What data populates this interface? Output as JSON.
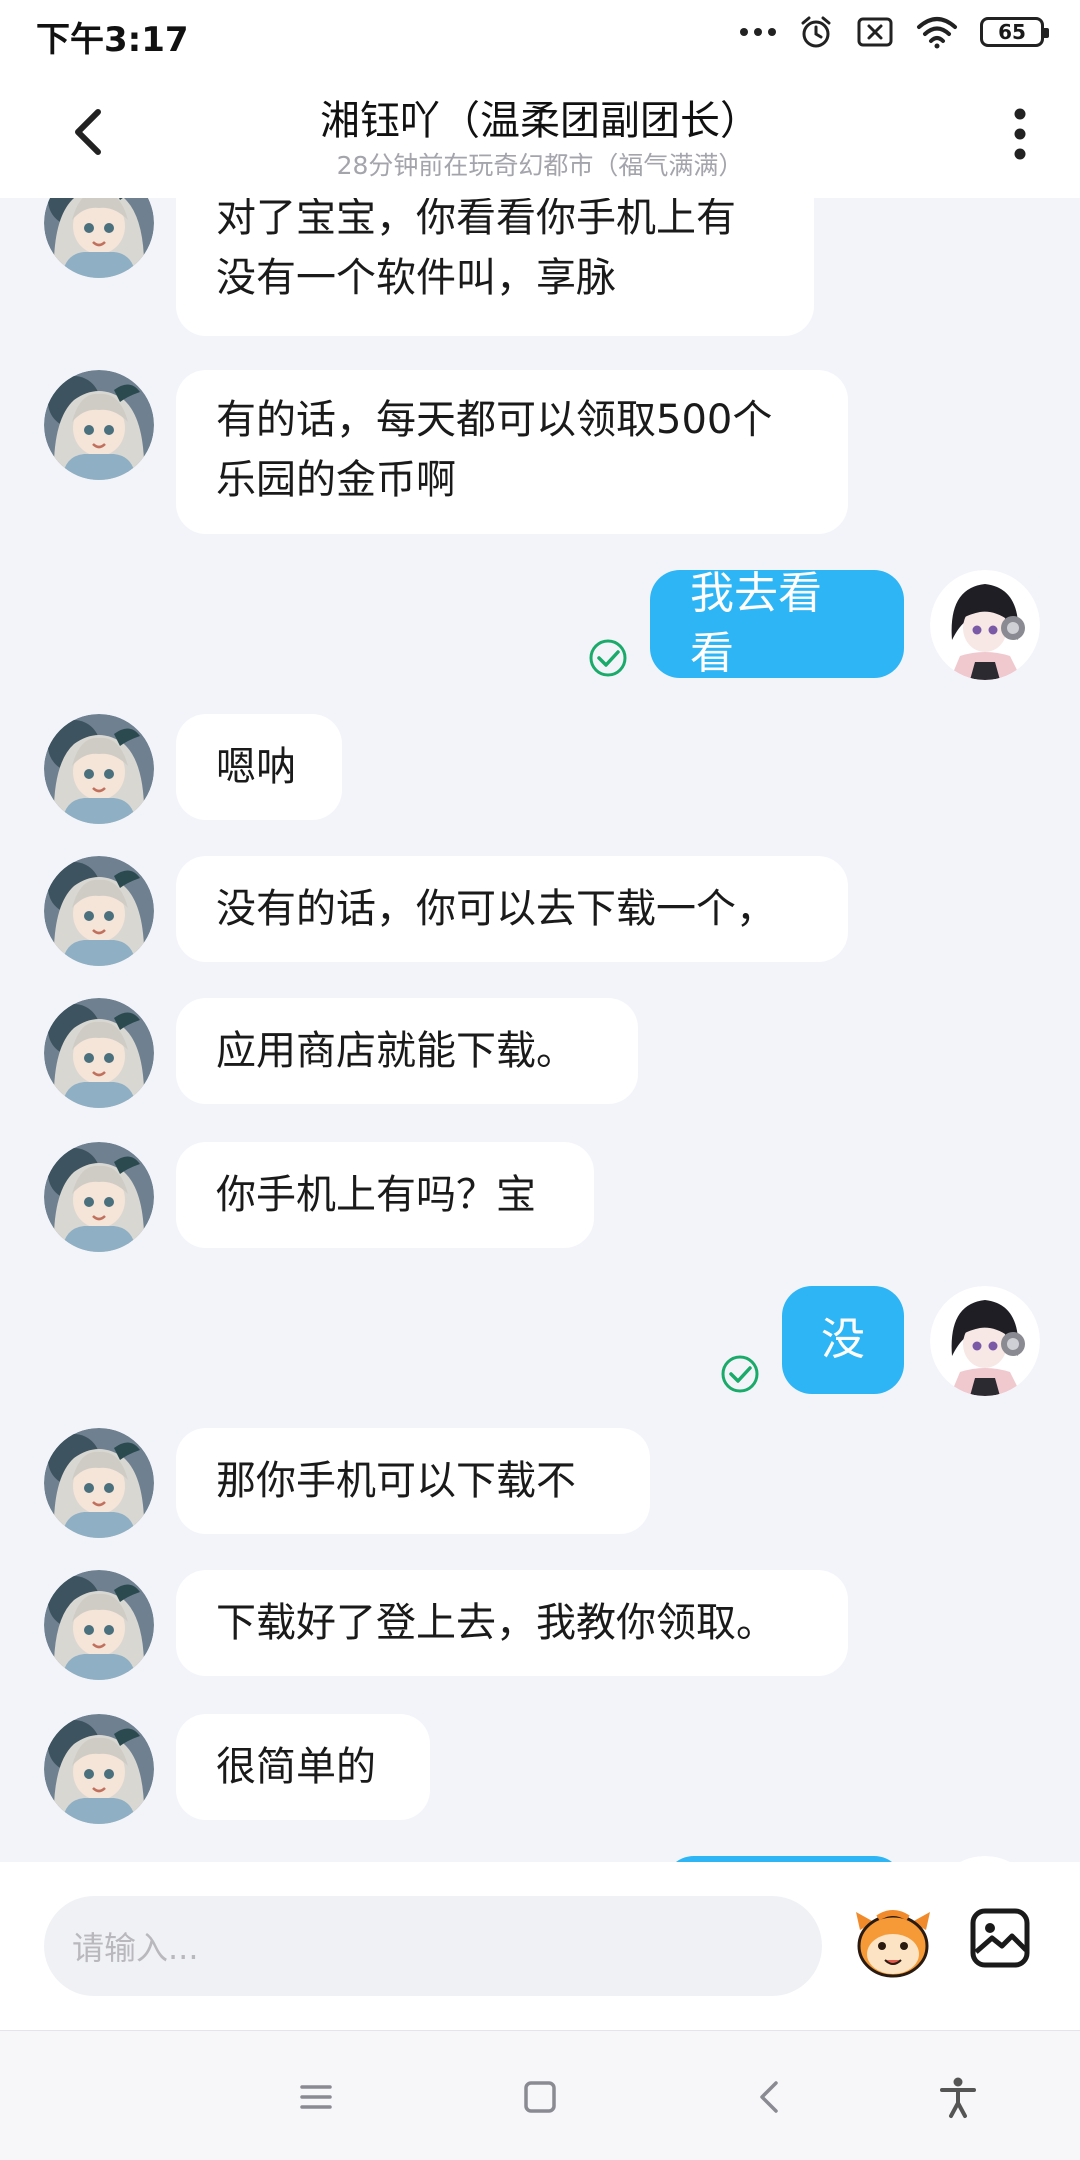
{
  "status_bar": {
    "time": "下午3:17",
    "battery_level": "65"
  },
  "header": {
    "title": "湘钰吖（温柔团副团长）",
    "subtitle": "28分钟前在玩奇幻都市（福气满满）"
  },
  "messages": [
    {
      "from": "contact",
      "text": "对了宝宝，你看看你手机上有没有一个软件叫，享脉"
    },
    {
      "from": "contact",
      "text": "有的话，每天都可以领取500个乐园的金币啊"
    },
    {
      "from": "me",
      "text": "我去看看",
      "read": true
    },
    {
      "from": "contact",
      "text": "嗯呐"
    },
    {
      "from": "contact",
      "text": "没有的话，你可以去下载一个，"
    },
    {
      "from": "contact",
      "text": "应用商店就能下载。"
    },
    {
      "from": "contact",
      "text": "你手机上有吗？宝"
    },
    {
      "from": "me",
      "text": "没",
      "read": true
    },
    {
      "from": "contact",
      "text": "那你手机可以下载不"
    },
    {
      "from": "contact",
      "text": "下载好了登上去，我教你领取。"
    },
    {
      "from": "contact",
      "text": "很简单的"
    }
  ],
  "input": {
    "placeholder": "请输入..."
  },
  "colors": {
    "outgoing_bubble": "#2db5f6",
    "incoming_bubble": "#ffffff",
    "background": "#f3f4f9",
    "read_check": "#1aaa6a"
  },
  "icons": [
    "back-arrow-icon",
    "more-vertical-icon",
    "emoji-face-icon",
    "image-icon",
    "menu-icon",
    "home-square-icon",
    "back-nav-icon",
    "accessibility-icon"
  ]
}
